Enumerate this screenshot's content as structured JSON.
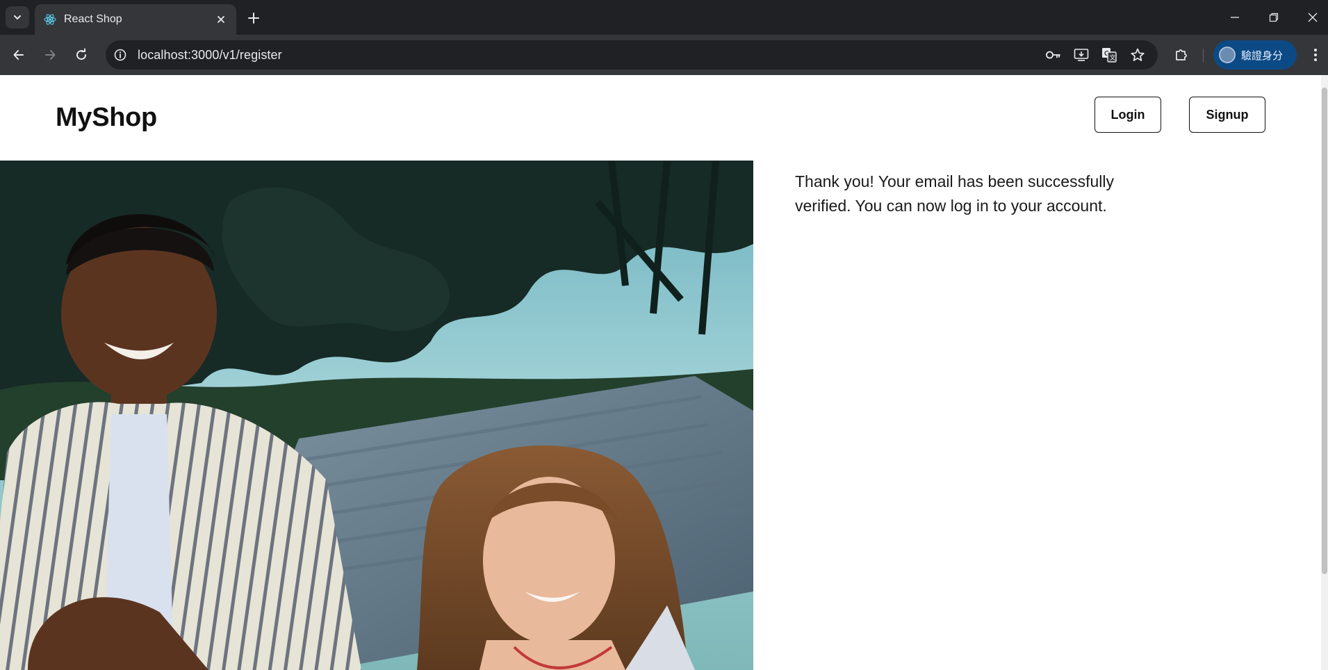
{
  "browser": {
    "tab": {
      "title": "React Shop",
      "favicon": "react-icon"
    },
    "url": "localhost:3000/v1/register",
    "profile_label": "驗證身分",
    "icons": [
      "tab-search-icon",
      "close-icon",
      "plus-icon",
      "minimize-icon",
      "restore-icon",
      "close-window-icon",
      "back-icon",
      "forward-icon",
      "reload-icon",
      "site-info-icon",
      "key-icon",
      "install-icon",
      "translate-icon",
      "star-icon",
      "extensions-icon",
      "menu-icon"
    ]
  },
  "page": {
    "brand": "MyShop",
    "nav": {
      "login_label": "Login",
      "signup_label": "Signup"
    },
    "verification_message": "Thank you! Your email has been successfully verified. You can now log in to your account.",
    "hero_image": "photo of two smiling children seated outdoors in front of trees at dusk"
  },
  "colors": {
    "chrome_dark": "#202124",
    "chrome_toolbar": "#35363a",
    "profile_pill": "#0c4a85",
    "page_bg": "#ffffff",
    "text": "#111111"
  }
}
